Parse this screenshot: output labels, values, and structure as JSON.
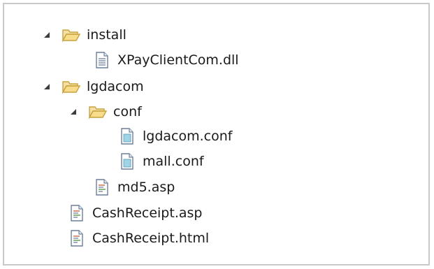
{
  "tree": {
    "items": [
      {
        "label": "install",
        "type": "folder",
        "expanded": true
      },
      {
        "label": "XPayClientCom.dll",
        "type": "dll-file"
      },
      {
        "label": "lgdacom",
        "type": "folder",
        "expanded": true
      },
      {
        "label": "conf",
        "type": "folder",
        "expanded": true
      },
      {
        "label": "lgdacom.conf",
        "type": "conf-file"
      },
      {
        "label": "mall.conf",
        "type": "conf-file"
      },
      {
        "label": "md5.asp",
        "type": "asp-file"
      },
      {
        "label": "CashReceipt.asp",
        "type": "asp-file"
      },
      {
        "label": "CashReceipt.html",
        "type": "html-file"
      }
    ]
  },
  "colors": {
    "folder_fill": "#f5d98a",
    "folder_stroke": "#c9a23c",
    "file_stroke": "#6d7f99",
    "conf_fill": "#9fd3e6",
    "border": "#c9c9c9"
  }
}
